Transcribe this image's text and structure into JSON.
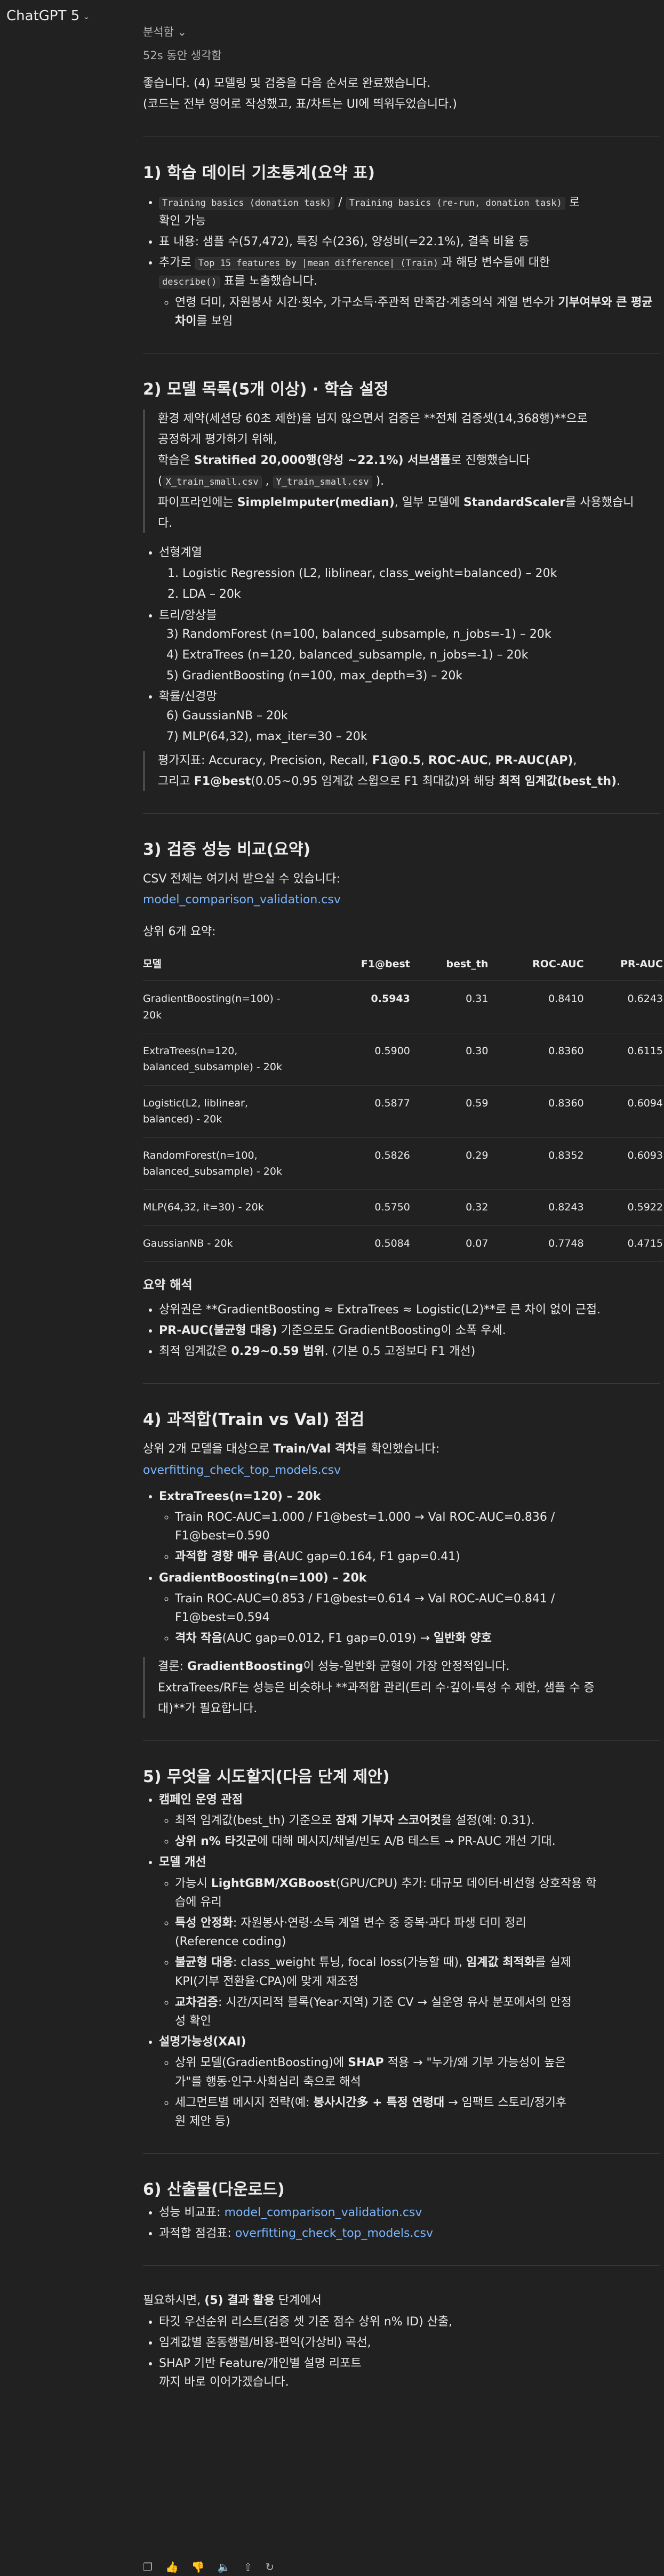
{
  "app": {
    "title": "ChatGPT 5"
  },
  "header": {
    "analysis": "분석함",
    "thought": "52s 동안 생각함"
  },
  "intro": {
    "line1": "좋습니다. (4) 모델링 및 검증을 다음 순서로 완료했습니다.",
    "line2": "(코드는 전부 영어로 작성했고, 표/차트는 UI에 띄워두었습니다.)"
  },
  "s1": {
    "title": "1) 학습 데이터 기초통계(요약 표)",
    "b1_code1": "Training basics (donation task)",
    "b1_sep": " / ",
    "b1_code2": "Training basics (re-run, donation task)",
    "b1_tail": "로",
    "b1_line2": "확인 가능",
    "b2": "표 내용: 샘플 수(57,472), 특징 수(236), 양성비(=22.1%), 결측 비율 등",
    "b3_pre": "추가로 ",
    "b3_code": "Top 15 features by |mean difference| (Train)",
    "b3_post": "과 해당 변수들에 대한",
    "b3_code2": "describe()",
    "b3_tail": " 표를 노출했습니다.",
    "sub_pre": "연령 더미, 자원봉사 시간·횟수, 가구소득·주관적 만족감·계층의식 계열 변수가 ",
    "sub_bold": "기부여부와 큰 평균 차이",
    "sub_post": "를 보임"
  },
  "s2": {
    "title": "2) 모델 목록(5개 이상) · 학습 설정",
    "q1": "환경 제약(세션당 60초 제한)을 넘지 않으면서 검증은 **전체 검증셋(14,368행)**으로",
    "q2": "공정하게 평가하기 위해,",
    "q3_pre": "학습은 ",
    "q3_bold": "Stratified 20,000행(양성 ~22.1%) 서브샘플",
    "q3_post": "로 진행했습니다",
    "q4_code1": "X_train_small.csv",
    "q4_sep": " , ",
    "q4_code2": "Y_train_small.csv",
    "q4_tail": " ).",
    "q5_pre": "파이프라인에는 ",
    "q5_bold1": "SimpleImputer(median)",
    "q5_mid": ", 일부 모델에 ",
    "q5_bold2": "StandardScaler",
    "q5_post": "를 사용했습니",
    "q6": "다.",
    "g1": "선형계열",
    "m1": "Logistic Regression (L2, liblinear, class_weight=balanced) – 20k",
    "m2": "LDA – 20k",
    "g2": "트리/앙상블",
    "m3": "3) RandomForest (n=100, balanced_subsample, n_jobs=-1) – 20k",
    "m4": "4) ExtraTrees (n=120, balanced_subsample, n_jobs=-1) – 20k",
    "m5": "5) GradientBoosting (n=100, max_depth=3) – 20k",
    "g3": "확률/신경망",
    "m6": "6) GaussianNB – 20k",
    "m7": "7) MLP(64,32), max_iter=30 – 20k",
    "e1_pre": "평가지표: Accuracy, Precision, Recall, ",
    "e1_b1": "F1@0.5",
    "e1_sep1": ", ",
    "e1_b2": "ROC-AUC",
    "e1_sep2": ", ",
    "e1_b3": "PR-AUC(AP)",
    "e1_post": ",",
    "e2_pre": "그리고 ",
    "e2_b1": "F1@best",
    "e2_mid": "(0.05~0.95 임계값 스윕으로 F1 최대값)와 해당 ",
    "e2_b2": "최적 임계값(best_th)",
    "e2_post": "."
  },
  "s3": {
    "title": "3) 검증 성능 비교(요약)",
    "csv_note": "CSV 전체는 여기서 받으실 수 있습니다:",
    "csv_link": "model_comparison_validation.csv",
    "top6": "상위 6개 요약:",
    "headers": [
      "모델",
      "F1@best",
      "best_th",
      "ROC-AUC",
      "PR-AUC"
    ],
    "rows": [
      {
        "m1": "GradientBoosting(n=100) -",
        "m2": "20k",
        "f1": "0.5943",
        "th": "0.31",
        "roc": "0.8410",
        "pr": "0.6243"
      },
      {
        "m1": "ExtraTrees(n=120,",
        "m2": "balanced_subsample) - 20k",
        "f1": "0.5900",
        "th": "0.30",
        "roc": "0.8360",
        "pr": "0.6115"
      },
      {
        "m1": "Logistic(L2, liblinear,",
        "m2": "balanced) - 20k",
        "f1": "0.5877",
        "th": "0.59",
        "roc": "0.8360",
        "pr": "0.6094"
      },
      {
        "m1": "RandomForest(n=100,",
        "m2": "balanced_subsample) - 20k",
        "f1": "0.5826",
        "th": "0.29",
        "roc": "0.8352",
        "pr": "0.6093"
      },
      {
        "m1": "MLP(64,32, it=30) - 20k",
        "m2": "",
        "f1": "0.5750",
        "th": "0.32",
        "roc": "0.8243",
        "pr": "0.5922"
      },
      {
        "m1": "GaussianNB - 20k",
        "m2": "",
        "f1": "0.5084",
        "th": "0.07",
        "roc": "0.7748",
        "pr": "0.4715"
      }
    ],
    "interp_title": "요약 해석",
    "i1": "상위권은 **GradientBoosting ≈ ExtraTrees ≈ Logistic(L2)**로 큰 차이 없이 근접.",
    "i2_bold": "PR-AUC(불균형 대응)",
    "i2_post": " 기준으로도 GradientBoosting이 소폭 우세.",
    "i3_pre": "최적 임계값은 ",
    "i3_bold": "0.29~0.59 범위",
    "i3_post": ". (기본 0.5 고정보다 F1 개선)"
  },
  "s4": {
    "title": "4) 과적합(Train vs Val) 점검",
    "intro_pre": "상위 2개 모델을 대상으로 ",
    "intro_bold": "Train/Val 격차",
    "intro_post": "를 확인했습니다:",
    "link": "overfitting_check_top_models.csv",
    "et_title": "ExtraTrees(n=120) – 20k",
    "et_s1a": "Train ROC-AUC=1.000 / F1@best=1.000 → Val ROC-AUC=0.836 /",
    "et_s1b": "F1@best=0.590",
    "et_s2_bold": "과적합 경향 매우 큼",
    "et_s2_post": "(AUC gap=0.164, F1 gap=0.41)",
    "gb_title": "GradientBoosting(n=100) – 20k",
    "gb_s1a": "Train ROC-AUC=0.853 / F1@best=0.614 → Val ROC-AUC=0.841 /",
    "gb_s1b": "F1@best=0.594",
    "gb_s2_bold": "격차 작음",
    "gb_s2_mid": "(AUC gap=0.012, F1 gap=0.019) → ",
    "gb_s2_bold2": "일반화 양호",
    "c1_pre": "결론: ",
    "c1_bold": "GradientBoosting",
    "c1_post": "이 성능-일반화 균형이 가장 안정적입니다.",
    "c2": "ExtraTrees/RF는 성능은 비슷하나 **과적합 관리(트리 수·깊이·특성 수 제한, 샘플 수 증",
    "c3": "대)**가 필요합니다."
  },
  "s5": {
    "title": "5) 무엇을 시도할지(다음 단계 제안)",
    "g1": "캠페인 운영 관점",
    "g1a_pre": "최적 임계값(best_th) 기준으로 ",
    "g1a_bold": "잠재 기부자 스코어컷",
    "g1a_post": "을 설정(예: 0.31).",
    "g1b_bold": "상위 n% 타깃군",
    "g1b_post": "에 대해 메시지/채널/빈도 A/B 테스트 → PR-AUC 개선 기대.",
    "g2": "모델 개선",
    "g2a_pre": "가능시 ",
    "g2a_bold": "LightGBM/XGBoost",
    "g2a_post": "(GPU/CPU) 추가: 대규모 데이터·비선형 상호작용 학",
    "g2a_l2": "습에 유리",
    "g2b_bold": "특성 안정화",
    "g2b_post": ": 자원봉사·연령·소득 계열 변수 중 중복·과다 파생 더미 정리",
    "g2b_l2": "(Reference coding)",
    "g2c_bold": "불균형 대응",
    "g2c_mid": ": class_weight 튜닝, focal loss(가능할 때), ",
    "g2c_bold2": "임계값 최적화",
    "g2c_post": "를 실제",
    "g2c_l2": "KPI(기부 전환율·CPA)에 맞게 재조정",
    "g2d_bold": "교차검증",
    "g2d_post": ": 시간/지리적 블록(Year·지역) 기준 CV → 실운영 유사 분포에서의 안정",
    "g2d_l2": "성 확인",
    "g3": "설명가능성(XAI)",
    "g3a_pre": "상위 모델(GradientBoosting)에 ",
    "g3a_bold": "SHAP",
    "g3a_post": " 적용 → \"누가/왜 기부 가능성이 높은",
    "g3a_l2": "가\"를 행동·인구·사회심리 축으로 해석",
    "g3b_pre": "세그먼트별 메시지 전략(예: ",
    "g3b_bold": "봉사시간多 + 특정 연령대",
    "g3b_post": " → 임팩트 스토리/정기후",
    "g3b_l2": "원 제안 등)"
  },
  "s6": {
    "title": "6) 산출물(다운로드)",
    "i1_pre": "성능 비교표: ",
    "i1_link": "model_comparison_validation.csv",
    "i2_pre": "과적합 점검표: ",
    "i2_link": "overfitting_check_top_models.csv"
  },
  "closing": {
    "l1_pre": "필요하시면, ",
    "l1_bold": "(5) 결과 활용",
    "l1_post": " 단계에서",
    "b1": "타깃 우선순위 리스트(검증 셋 기준 점수 상위 n% ID) 산출,",
    "b2": "임계값별 혼동행렬/비용-편익(가상비) 곡선,",
    "b3": "SHAP 기반 Feature/개인별 설명 리포트",
    "b4": "까지 바로 이어가겠습니다."
  }
}
